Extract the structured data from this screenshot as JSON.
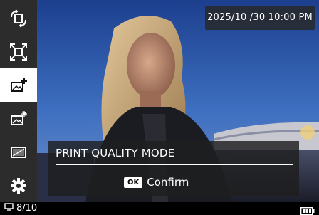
{
  "overlay": {
    "datetime": "2025/10 /30  10:00 PM"
  },
  "menu": {
    "items": [
      {
        "icon": "rotate-icon",
        "selected": false
      },
      {
        "icon": "fullscreen-frame-icon",
        "selected": false
      },
      {
        "icon": "photo-add-icon",
        "selected": true
      },
      {
        "icon": "photo-sparkle-icon",
        "selected": false
      },
      {
        "icon": "photo-frame-icon",
        "selected": false
      },
      {
        "icon": "gear-icon",
        "selected": false
      }
    ]
  },
  "dialog": {
    "title": "PRINT QUALITY MODE",
    "confirm_key": "OK",
    "confirm_label": "Confirm"
  },
  "status": {
    "counter": "8/10",
    "battery_icon": "battery-full-icon"
  },
  "colors": {
    "rail_bg": "#2c2c2c",
    "selected_bg": "#ffffff",
    "dialog_bg": "#1e1e1e"
  }
}
